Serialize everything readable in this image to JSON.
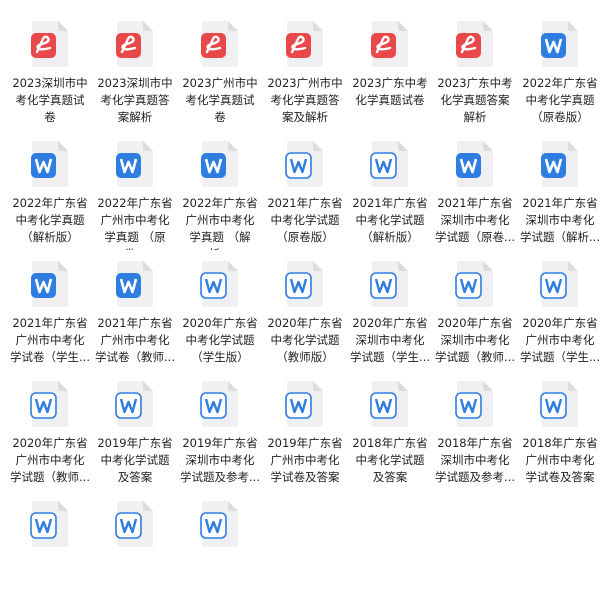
{
  "files": [
    {
      "type": "pdf",
      "name": "2023深圳市中考化学真题试卷"
    },
    {
      "type": "pdf",
      "name": "2023深圳市中考化学真题答案解析"
    },
    {
      "type": "pdf",
      "name": "2023广州市中考化学真题试卷"
    },
    {
      "type": "pdf",
      "name": "2023广州市中考化学真题答案及解析"
    },
    {
      "type": "pdf",
      "name": "2023广东中考化学真题试卷"
    },
    {
      "type": "pdf",
      "name": "2023广东中考化学真题答案解析"
    },
    {
      "type": "word",
      "name": "2022年广东省中考化学真题 （原卷版）"
    },
    {
      "type": "word",
      "name": "2022年广东省中考化学真题 （解析版）"
    },
    {
      "type": "word",
      "name": "2022年广东省广州市中考化学真题 （原卷..."
    },
    {
      "type": "word",
      "name": "2022年广东省广州市中考化学真题 （解析..."
    },
    {
      "type": "word-light",
      "name": "2021年广东省中考化学试题（原卷版）"
    },
    {
      "type": "word-light",
      "name": "2021年广东省中考化学试题（解析版）"
    },
    {
      "type": "word",
      "name": "2021年广东省深圳市中考化学试题（原卷..."
    },
    {
      "type": "word",
      "name": "2021年广东省深圳市中考化学试题（解析..."
    },
    {
      "type": "word",
      "name": "2021年广东省广州市中考化学试卷（学生..."
    },
    {
      "type": "word",
      "name": "2021年广东省广州市中考化学试卷（教师..."
    },
    {
      "type": "word-light",
      "name": "2020年广东省中考化学试题（学生版）"
    },
    {
      "type": "word-light",
      "name": "2020年广东省中考化学试题（教师版）"
    },
    {
      "type": "word-light",
      "name": "2020年广东省深圳市中考化学试题（学生..."
    },
    {
      "type": "word-light",
      "name": "2020年广东省深圳市中考化学试题（教师..."
    },
    {
      "type": "word-light",
      "name": "2020年广东省广州市中考化学试题（学生..."
    },
    {
      "type": "word-light",
      "name": "2020年广东省广州市中考化学试题（教师..."
    },
    {
      "type": "word-light",
      "name": "2019年广东省中考化学试题及答案"
    },
    {
      "type": "word-light",
      "name": "2019年广东省深圳市中考化学试题及参考..."
    },
    {
      "type": "word-light",
      "name": "2019年广东省广州市中考化学试卷及答案"
    },
    {
      "type": "word-light",
      "name": "2018年广东省中考化学试题及答案"
    },
    {
      "type": "word-light",
      "name": "2018年广东省深圳市中考化学试题及参考..."
    },
    {
      "type": "word-light",
      "name": "2018年广东省广州市中考化学试卷及答案"
    },
    {
      "type": "word-light",
      "name": ""
    },
    {
      "type": "word-light",
      "name": ""
    },
    {
      "type": "word-light",
      "name": ""
    }
  ],
  "colors": {
    "pdf": "#e8484a",
    "word": "#2f7de1",
    "word_light_stroke": "#2f7de1",
    "page": "#f0f0f2",
    "fold": "#dcdcdf"
  }
}
